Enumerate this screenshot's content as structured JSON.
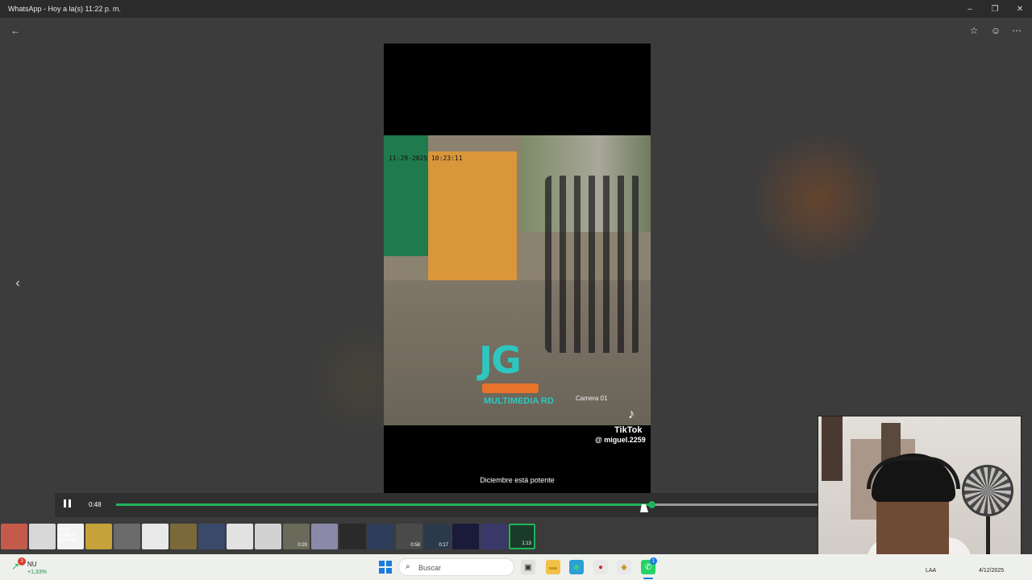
{
  "window": {
    "title": "WhatsApp - Hoy a la(s) 11:22 p. m.",
    "controls": {
      "minimize": "–",
      "maximize": "❐",
      "close": "✕"
    }
  },
  "viewer": {
    "back_icon": "←",
    "prev_icon": "‹",
    "star_icon": "☆",
    "emoji_icon": "☺",
    "more_icon": "⋯"
  },
  "video": {
    "overlay_timestamp": "11-29-2025 10:23:11",
    "camera_label": "Camera 01",
    "logo_text": "JG",
    "logo_subtext": "MULTIMEDIA RD",
    "tiktok_icon": "♪",
    "tiktok_brand": "TikTok",
    "tiktok_user": "@ miguel.2259",
    "caption": "Diciembre está potente"
  },
  "player": {
    "current_time": "0:48",
    "progress_fraction": 0.763
  },
  "thumbnails": [
    {
      "kind": "image",
      "color": "#c45a4a"
    },
    {
      "kind": "image",
      "color": "#d8d8d8"
    },
    {
      "kind": "image",
      "color": "#f3f3f3",
      "text": "YOUT ¡MANGU GOLPES"
    },
    {
      "kind": "image",
      "color": "#c7a23a"
    },
    {
      "kind": "image",
      "color": "#6b6b6b"
    },
    {
      "kind": "image",
      "color": "#e9e9e9"
    },
    {
      "kind": "image",
      "color": "#7a6a3a"
    },
    {
      "kind": "image",
      "color": "#3a4a6a"
    },
    {
      "kind": "image",
      "color": "#e2e2e2"
    },
    {
      "kind": "image",
      "color": "#d2d2d2"
    },
    {
      "kind": "video",
      "color": "#6a6a5a",
      "duration": "0:20"
    },
    {
      "kind": "image",
      "color": "#8a8aa8"
    },
    {
      "kind": "image",
      "color": "#2a2a2a"
    },
    {
      "kind": "image",
      "color": "#2e3e5a"
    },
    {
      "kind": "video",
      "color": "#4a4a4a",
      "duration": "0:58"
    },
    {
      "kind": "video",
      "color": "#2a3a4a",
      "duration": "0:17"
    },
    {
      "kind": "image",
      "color": "#1a1a3a"
    },
    {
      "kind": "image",
      "color": "#3a3a6a"
    },
    {
      "kind": "video",
      "color": "#1a3a2a",
      "duration": "1:13",
      "selected": true
    }
  ],
  "taskbar": {
    "weather_badge": "3",
    "weather_name": "NU",
    "weather_change": "+1,33%",
    "search_placeholder": "Buscar",
    "whatsapp_badge": "1",
    "lang": "LAA",
    "date": "4/12/2025",
    "icons": [
      {
        "name": "task-view-icon",
        "glyph": "▣",
        "bg": "#e0e0e0",
        "color": "#333"
      },
      {
        "name": "file-explorer-icon",
        "glyph": "▬",
        "bg": "#f2c14a",
        "color": "#c79a20"
      },
      {
        "name": "edge-icon",
        "glyph": "◉",
        "bg": "#2a9fd8",
        "color": "#3fd07a"
      },
      {
        "name": "chrome-icon",
        "glyph": "●",
        "bg": "#e8e8e8",
        "color": "#c33"
      },
      {
        "name": "app-icon",
        "glyph": "◆",
        "bg": "#e8e8e8",
        "color": "#c49a2a"
      },
      {
        "name": "whatsapp-icon",
        "glyph": "✆",
        "bg": "#25d366",
        "color": "#fff"
      }
    ]
  }
}
